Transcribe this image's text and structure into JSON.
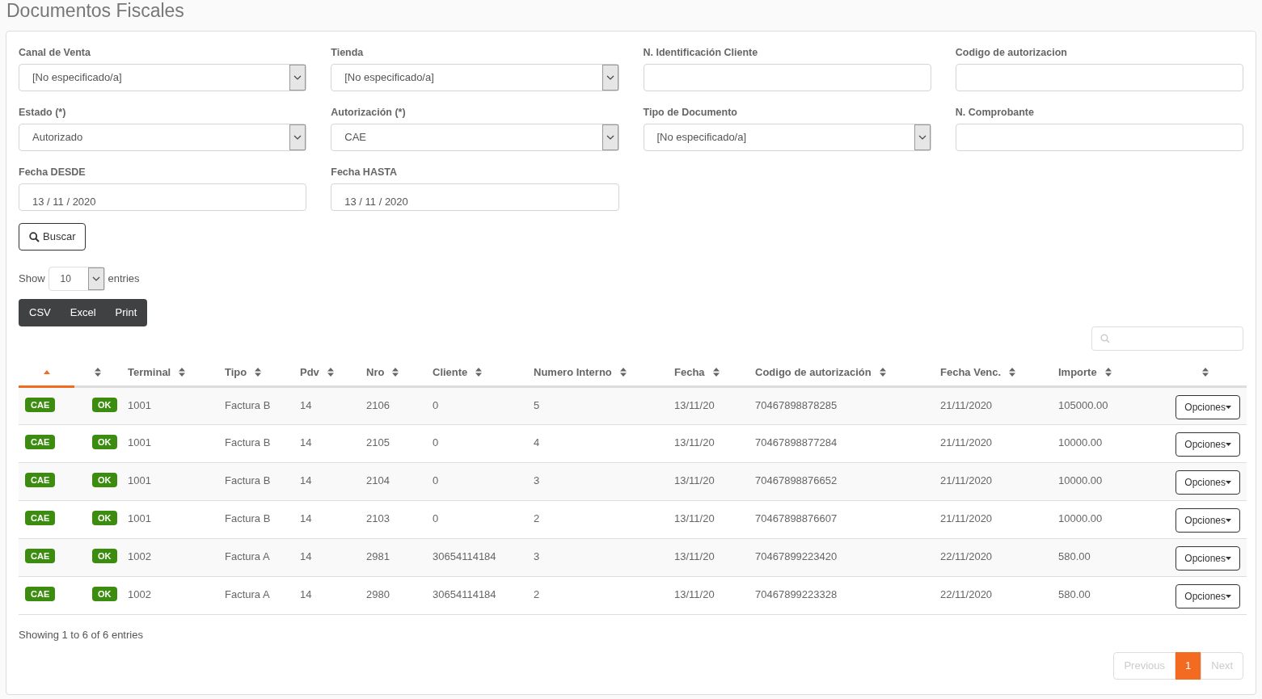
{
  "page_title": "Documentos Fiscales",
  "filters": [
    {
      "kind": "select",
      "label": "Canal de Venta",
      "value": "[No especificado/a]"
    },
    {
      "kind": "select",
      "label": "Tienda",
      "value": "[No especificado/a]"
    },
    {
      "kind": "text",
      "label": "N. Identificación Cliente"
    },
    {
      "kind": "text",
      "label": "Codigo de autorizacion"
    },
    {
      "kind": "select",
      "label": "Estado (*)",
      "value": "Autorizado"
    },
    {
      "kind": "select",
      "label": "Autorización (*)",
      "value": "CAE"
    },
    {
      "kind": "select",
      "label": "Tipo de Documento",
      "value": "[No especificado/a]"
    },
    {
      "kind": "text",
      "label": "N. Comprobante"
    },
    {
      "kind": "date",
      "label": "Fecha DESDE",
      "value": "13 / 11 / 2020"
    },
    {
      "kind": "date",
      "label": "Fecha HASTA",
      "value": "13 / 11 / 2020"
    }
  ],
  "search_button": "Buscar",
  "length": {
    "before": "Show",
    "value": "10",
    "after": "entries"
  },
  "export_buttons": [
    "CSV",
    "Excel",
    "Print"
  ],
  "table": {
    "columns": [
      {
        "sorted": true
      },
      {
        "sorted": false
      },
      {
        "label": "Terminal",
        "sorted": false
      },
      {
        "label": "Tipo",
        "sorted": false
      },
      {
        "label": "Pdv",
        "sorted": false
      },
      {
        "label": "Nro",
        "sorted": false
      },
      {
        "label": "Cliente",
        "sorted": false
      },
      {
        "label": "Numero Interno",
        "sorted": false
      },
      {
        "label": "Fecha",
        "sorted": false
      },
      {
        "label": "Codigo de autorización",
        "sorted": false
      },
      {
        "label": "Fecha Venc.",
        "sorted": false
      },
      {
        "label": "Importe",
        "sorted": false
      },
      {
        "sorted": false
      }
    ],
    "rows": [
      {
        "cells": [
          {
            "kind": "badge",
            "text": "CAE"
          },
          {
            "kind": "badge",
            "text": "OK"
          },
          {
            "kind": "text",
            "text": "1001"
          },
          {
            "kind": "text",
            "text": "Factura B"
          },
          {
            "kind": "text",
            "text": "14"
          },
          {
            "kind": "text",
            "text": "2106"
          },
          {
            "kind": "text",
            "text": "0"
          },
          {
            "kind": "text",
            "text": "5"
          },
          {
            "kind": "text",
            "text": "13/11/20"
          },
          {
            "kind": "text",
            "text": "70467898878285"
          },
          {
            "kind": "text",
            "text": "21/11/2020"
          },
          {
            "kind": "text",
            "text": "105000.00"
          },
          {
            "kind": "button",
            "text": "Opciones"
          }
        ]
      },
      {
        "cells": [
          {
            "kind": "badge",
            "text": "CAE"
          },
          {
            "kind": "badge",
            "text": "OK"
          },
          {
            "kind": "text",
            "text": "1001"
          },
          {
            "kind": "text",
            "text": "Factura B"
          },
          {
            "kind": "text",
            "text": "14"
          },
          {
            "kind": "text",
            "text": "2105"
          },
          {
            "kind": "text",
            "text": "0"
          },
          {
            "kind": "text",
            "text": "4"
          },
          {
            "kind": "text",
            "text": "13/11/20"
          },
          {
            "kind": "text",
            "text": "70467898877284"
          },
          {
            "kind": "text",
            "text": "21/11/2020"
          },
          {
            "kind": "text",
            "text": "10000.00"
          },
          {
            "kind": "button",
            "text": "Opciones"
          }
        ]
      },
      {
        "cells": [
          {
            "kind": "badge",
            "text": "CAE"
          },
          {
            "kind": "badge",
            "text": "OK"
          },
          {
            "kind": "text",
            "text": "1001"
          },
          {
            "kind": "text",
            "text": "Factura B"
          },
          {
            "kind": "text",
            "text": "14"
          },
          {
            "kind": "text",
            "text": "2104"
          },
          {
            "kind": "text",
            "text": "0"
          },
          {
            "kind": "text",
            "text": "3"
          },
          {
            "kind": "text",
            "text": "13/11/20"
          },
          {
            "kind": "text",
            "text": "70467898876652"
          },
          {
            "kind": "text",
            "text": "21/11/2020"
          },
          {
            "kind": "text",
            "text": "10000.00"
          },
          {
            "kind": "button",
            "text": "Opciones"
          }
        ]
      },
      {
        "cells": [
          {
            "kind": "badge",
            "text": "CAE"
          },
          {
            "kind": "badge",
            "text": "OK"
          },
          {
            "kind": "text",
            "text": "1001"
          },
          {
            "kind": "text",
            "text": "Factura B"
          },
          {
            "kind": "text",
            "text": "14"
          },
          {
            "kind": "text",
            "text": "2103"
          },
          {
            "kind": "text",
            "text": "0"
          },
          {
            "kind": "text",
            "text": "2"
          },
          {
            "kind": "text",
            "text": "13/11/20"
          },
          {
            "kind": "text",
            "text": "70467898876607"
          },
          {
            "kind": "text",
            "text": "21/11/2020"
          },
          {
            "kind": "text",
            "text": "10000.00"
          },
          {
            "kind": "button",
            "text": "Opciones"
          }
        ]
      },
      {
        "cells": [
          {
            "kind": "badge",
            "text": "CAE"
          },
          {
            "kind": "badge",
            "text": "OK"
          },
          {
            "kind": "text",
            "text": "1002"
          },
          {
            "kind": "text",
            "text": "Factura A"
          },
          {
            "kind": "text",
            "text": "14"
          },
          {
            "kind": "text",
            "text": "2981"
          },
          {
            "kind": "text",
            "text": "30654114184"
          },
          {
            "kind": "text",
            "text": "3"
          },
          {
            "kind": "text",
            "text": "13/11/20"
          },
          {
            "kind": "text",
            "text": "70467899223420"
          },
          {
            "kind": "text",
            "text": "22/11/2020"
          },
          {
            "kind": "text",
            "text": "580.00"
          },
          {
            "kind": "button",
            "text": "Opciones"
          }
        ]
      },
      {
        "cells": [
          {
            "kind": "badge",
            "text": "CAE"
          },
          {
            "kind": "badge",
            "text": "OK"
          },
          {
            "kind": "text",
            "text": "1002"
          },
          {
            "kind": "text",
            "text": "Factura A"
          },
          {
            "kind": "text",
            "text": "14"
          },
          {
            "kind": "text",
            "text": "2980"
          },
          {
            "kind": "text",
            "text": "30654114184"
          },
          {
            "kind": "text",
            "text": "2"
          },
          {
            "kind": "text",
            "text": "13/11/20"
          },
          {
            "kind": "text",
            "text": "70467899223328"
          },
          {
            "kind": "text",
            "text": "22/11/2020"
          },
          {
            "kind": "text",
            "text": "580.00"
          },
          {
            "kind": "button",
            "text": "Opciones"
          }
        ]
      }
    ]
  },
  "info": "Showing 1 to 6 of 6 entries",
  "pagination": {
    "previous": {
      "label": "Previous",
      "disabled": true
    },
    "pages": [
      {
        "label": "1",
        "selected": true
      }
    ],
    "next": {
      "label": "Next",
      "disabled": true
    }
  }
}
